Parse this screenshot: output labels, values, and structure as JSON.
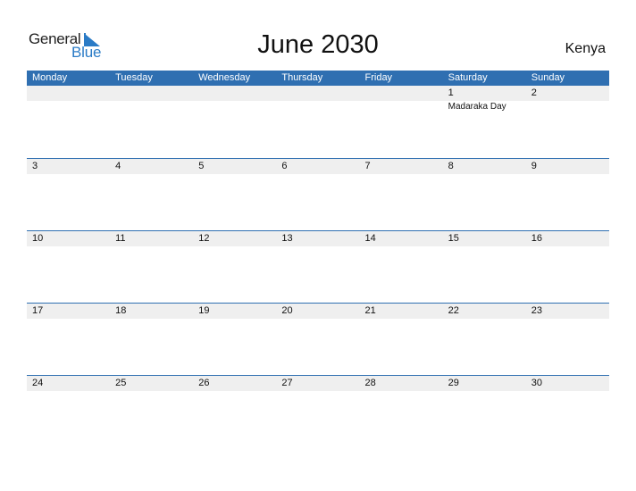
{
  "logo": {
    "word1": "General",
    "word2": "Blue"
  },
  "title": "June 2030",
  "country": "Kenya",
  "weekdays": [
    "Monday",
    "Tuesday",
    "Wednesday",
    "Thursday",
    "Friday",
    "Saturday",
    "Sunday"
  ],
  "weeks": [
    {
      "days": [
        "",
        "",
        "",
        "",
        "",
        "1",
        "2"
      ],
      "events": [
        "",
        "",
        "",
        "",
        "",
        "Madaraka Day",
        ""
      ]
    },
    {
      "days": [
        "3",
        "4",
        "5",
        "6",
        "7",
        "8",
        "9"
      ],
      "events": [
        "",
        "",
        "",
        "",
        "",
        "",
        ""
      ]
    },
    {
      "days": [
        "10",
        "11",
        "12",
        "13",
        "14",
        "15",
        "16"
      ],
      "events": [
        "",
        "",
        "",
        "",
        "",
        "",
        ""
      ]
    },
    {
      "days": [
        "17",
        "18",
        "19",
        "20",
        "21",
        "22",
        "23"
      ],
      "events": [
        "",
        "",
        "",
        "",
        "",
        "",
        ""
      ]
    },
    {
      "days": [
        "24",
        "25",
        "26",
        "27",
        "28",
        "29",
        "30"
      ],
      "events": [
        "",
        "",
        "",
        "",
        "",
        "",
        ""
      ]
    }
  ],
  "colors": {
    "accent": "#2f6fb1",
    "logo_blue": "#2a7bc6",
    "date_strip": "#efefef"
  }
}
